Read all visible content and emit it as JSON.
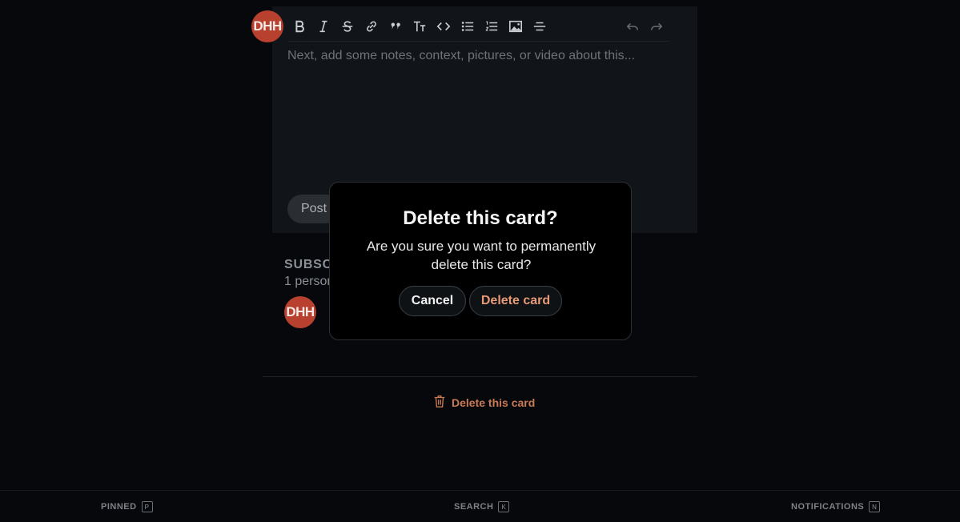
{
  "composer": {
    "avatar_initials": "DHH",
    "placeholder": "Next, add some notes, context, pictures, or video about this...",
    "post_label": "Post",
    "toolbar": [
      {
        "name": "bold-icon"
      },
      {
        "name": "italic-icon"
      },
      {
        "name": "strikethrough-icon"
      },
      {
        "name": "link-icon"
      },
      {
        "name": "quote-icon"
      },
      {
        "name": "heading-icon"
      },
      {
        "name": "code-icon"
      },
      {
        "name": "bullet-list-icon"
      },
      {
        "name": "numbered-list-icon"
      },
      {
        "name": "image-icon"
      },
      {
        "name": "divider-icon"
      },
      {
        "name": "undo-icon"
      },
      {
        "name": "redo-icon"
      }
    ]
  },
  "subscribers": {
    "title": "SUBSCR",
    "count": "1 person",
    "avatar_initials": "DHH"
  },
  "delete_link": {
    "label": "Delete this card"
  },
  "modal": {
    "title": "Delete this card?",
    "body": "Are you sure you want to permanently delete this card?",
    "cancel_label": "Cancel",
    "confirm_label": "Delete card"
  },
  "bottom_bar": {
    "pinned": {
      "label": "PINNED",
      "key": "P"
    },
    "search": {
      "label": "SEARCH",
      "key": "K"
    },
    "notifications": {
      "label": "NOTIFICATIONS",
      "key": "N"
    }
  },
  "colors": {
    "background": "#06080b",
    "card": "#111418",
    "avatar": "#b8402f",
    "danger_text": "#e79a77"
  }
}
